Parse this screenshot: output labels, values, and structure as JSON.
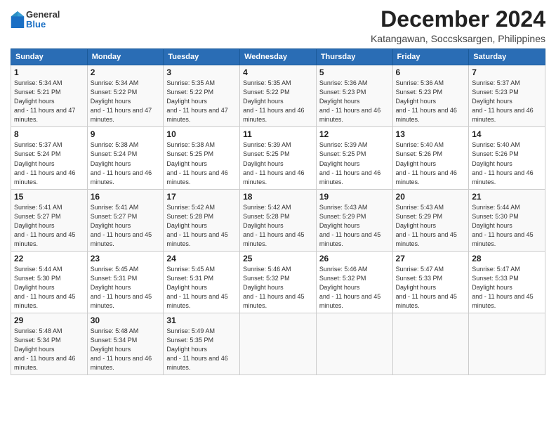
{
  "logo": {
    "general": "General",
    "blue": "Blue"
  },
  "title": "December 2024",
  "subtitle": "Katangawan, Soccsksargen, Philippines",
  "header_days": [
    "Sunday",
    "Monday",
    "Tuesday",
    "Wednesday",
    "Thursday",
    "Friday",
    "Saturday"
  ],
  "weeks": [
    [
      {
        "day": "1",
        "sunrise": "5:34 AM",
        "sunset": "5:21 PM",
        "daylight": "11 hours and 47 minutes."
      },
      {
        "day": "2",
        "sunrise": "5:34 AM",
        "sunset": "5:22 PM",
        "daylight": "11 hours and 47 minutes."
      },
      {
        "day": "3",
        "sunrise": "5:35 AM",
        "sunset": "5:22 PM",
        "daylight": "11 hours and 47 minutes."
      },
      {
        "day": "4",
        "sunrise": "5:35 AM",
        "sunset": "5:22 PM",
        "daylight": "11 hours and 46 minutes."
      },
      {
        "day": "5",
        "sunrise": "5:36 AM",
        "sunset": "5:23 PM",
        "daylight": "11 hours and 46 minutes."
      },
      {
        "day": "6",
        "sunrise": "5:36 AM",
        "sunset": "5:23 PM",
        "daylight": "11 hours and 46 minutes."
      },
      {
        "day": "7",
        "sunrise": "5:37 AM",
        "sunset": "5:23 PM",
        "daylight": "11 hours and 46 minutes."
      }
    ],
    [
      {
        "day": "8",
        "sunrise": "5:37 AM",
        "sunset": "5:24 PM",
        "daylight": "11 hours and 46 minutes."
      },
      {
        "day": "9",
        "sunrise": "5:38 AM",
        "sunset": "5:24 PM",
        "daylight": "11 hours and 46 minutes."
      },
      {
        "day": "10",
        "sunrise": "5:38 AM",
        "sunset": "5:25 PM",
        "daylight": "11 hours and 46 minutes."
      },
      {
        "day": "11",
        "sunrise": "5:39 AM",
        "sunset": "5:25 PM",
        "daylight": "11 hours and 46 minutes."
      },
      {
        "day": "12",
        "sunrise": "5:39 AM",
        "sunset": "5:25 PM",
        "daylight": "11 hours and 46 minutes."
      },
      {
        "day": "13",
        "sunrise": "5:40 AM",
        "sunset": "5:26 PM",
        "daylight": "11 hours and 46 minutes."
      },
      {
        "day": "14",
        "sunrise": "5:40 AM",
        "sunset": "5:26 PM",
        "daylight": "11 hours and 46 minutes."
      }
    ],
    [
      {
        "day": "15",
        "sunrise": "5:41 AM",
        "sunset": "5:27 PM",
        "daylight": "11 hours and 45 minutes."
      },
      {
        "day": "16",
        "sunrise": "5:41 AM",
        "sunset": "5:27 PM",
        "daylight": "11 hours and 45 minutes."
      },
      {
        "day": "17",
        "sunrise": "5:42 AM",
        "sunset": "5:28 PM",
        "daylight": "11 hours and 45 minutes."
      },
      {
        "day": "18",
        "sunrise": "5:42 AM",
        "sunset": "5:28 PM",
        "daylight": "11 hours and 45 minutes."
      },
      {
        "day": "19",
        "sunrise": "5:43 AM",
        "sunset": "5:29 PM",
        "daylight": "11 hours and 45 minutes."
      },
      {
        "day": "20",
        "sunrise": "5:43 AM",
        "sunset": "5:29 PM",
        "daylight": "11 hours and 45 minutes."
      },
      {
        "day": "21",
        "sunrise": "5:44 AM",
        "sunset": "5:30 PM",
        "daylight": "11 hours and 45 minutes."
      }
    ],
    [
      {
        "day": "22",
        "sunrise": "5:44 AM",
        "sunset": "5:30 PM",
        "daylight": "11 hours and 45 minutes."
      },
      {
        "day": "23",
        "sunrise": "5:45 AM",
        "sunset": "5:31 PM",
        "daylight": "11 hours and 45 minutes."
      },
      {
        "day": "24",
        "sunrise": "5:45 AM",
        "sunset": "5:31 PM",
        "daylight": "11 hours and 45 minutes."
      },
      {
        "day": "25",
        "sunrise": "5:46 AM",
        "sunset": "5:32 PM",
        "daylight": "11 hours and 45 minutes."
      },
      {
        "day": "26",
        "sunrise": "5:46 AM",
        "sunset": "5:32 PM",
        "daylight": "11 hours and 45 minutes."
      },
      {
        "day": "27",
        "sunrise": "5:47 AM",
        "sunset": "5:33 PM",
        "daylight": "11 hours and 45 minutes."
      },
      {
        "day": "28",
        "sunrise": "5:47 AM",
        "sunset": "5:33 PM",
        "daylight": "11 hours and 45 minutes."
      }
    ],
    [
      {
        "day": "29",
        "sunrise": "5:48 AM",
        "sunset": "5:34 PM",
        "daylight": "11 hours and 46 minutes."
      },
      {
        "day": "30",
        "sunrise": "5:48 AM",
        "sunset": "5:34 PM",
        "daylight": "11 hours and 46 minutes."
      },
      {
        "day": "31",
        "sunrise": "5:49 AM",
        "sunset": "5:35 PM",
        "daylight": "11 hours and 46 minutes."
      },
      null,
      null,
      null,
      null
    ]
  ]
}
